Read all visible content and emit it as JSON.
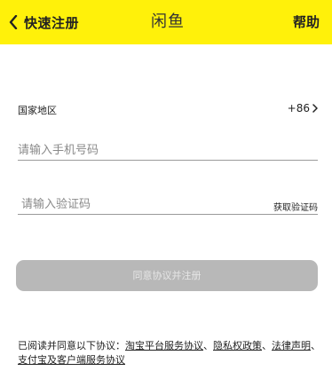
{
  "header": {
    "back_label": "快速注册",
    "logo_text": "闲鱼",
    "help_label": "帮助",
    "background_color": "#fff10a"
  },
  "region": {
    "label": "国家地区",
    "code": "+86"
  },
  "phone": {
    "placeholder": "请输入手机号码"
  },
  "verification": {
    "placeholder": "请输入验证码",
    "get_code_label": "获取验证码"
  },
  "submit": {
    "label": "同意协议并注册"
  },
  "agreement": {
    "prefix": "已阅读并同意以下协议：",
    "link_1": "淘宝平台服务协议",
    "sep_1": "、",
    "link_2": "隐私权政策",
    "sep_2": "、",
    "link_3": "法律声明",
    "sep_3": "、",
    "link_4": "支付宝及客户端服务协议"
  },
  "icons": {
    "back": "chevron-left-icon",
    "region_arrow": "chevron-right-icon"
  }
}
